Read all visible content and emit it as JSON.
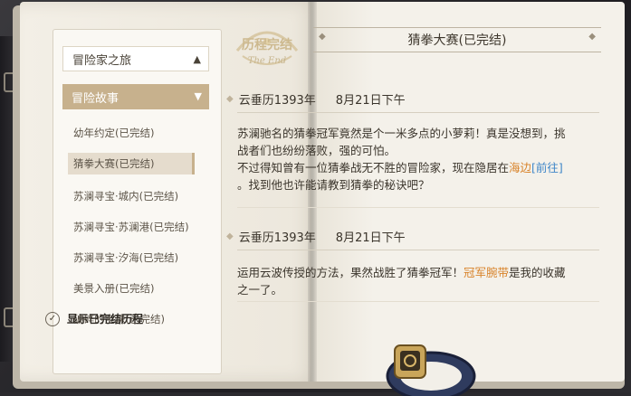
{
  "sidebar": {
    "section_top": "冒险家之旅",
    "section_active": "冒险故事",
    "items": [
      {
        "label": "幼年约定(已完结)"
      },
      {
        "label": "猜拳大赛(已完结)"
      },
      {
        "label": "苏澜寻宝·城内(已完结)"
      },
      {
        "label": "苏澜寻宝·苏澜港(已完结)"
      },
      {
        "label": "苏澜寻宝·汐海(已完结)"
      },
      {
        "label": "美景入册(已完结)"
      },
      {
        "label": "破碎的宝珠(已完结)"
      }
    ],
    "show_done_label": "显示已完结历程"
  },
  "stamp": {
    "top": "历程完结",
    "bottom": "The End"
  },
  "content": {
    "title": "猜拳大赛(已完结)",
    "entries": [
      {
        "date": "云垂历1393年",
        "time": "8月21日下午",
        "line1": "苏澜驰名的猜拳冠军竟然是个一米多点的小萝莉！真是没想到，挑",
        "line2": "战者们也纷纷落败，强的可怕。",
        "line3a": "不过得知曾有一位猜拳战无不胜的冒险家，现在隐居在",
        "place": "海边",
        "link": "[前往]",
        "line4": "。找到他也许能请教到猜拳的秘诀吧？"
      },
      {
        "date": "云垂历1393年",
        "time": "8月21日下午",
        "line1a": "运用云波传授的方法，果然战胜了猜拳冠军！",
        "item": "冠军腕带",
        "line1b": "是我的收藏",
        "line2": "之一了。"
      }
    ]
  },
  "colors": {
    "accent": "#c7b18d",
    "highlight": "#d8832a",
    "link": "#3f86c8"
  }
}
